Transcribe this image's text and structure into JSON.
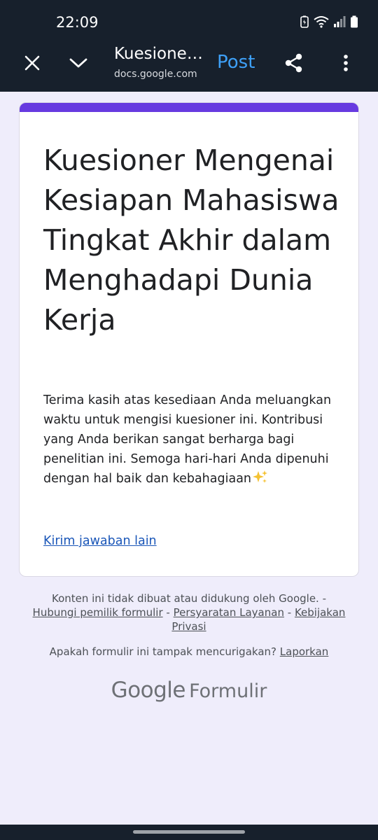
{
  "status_bar": {
    "time": "22:09",
    "icons": [
      "battery-saver-icon",
      "wifi-icon",
      "signal-icon",
      "battery-icon"
    ]
  },
  "browser_toolbar": {
    "title": "Kuesioner Mengenai Kesiapan Mahasiswa Tingkat Akhir dalam Menghadapi Dunia Kerja",
    "url": "docs.google.com",
    "post_label": "Post",
    "icons": [
      "close-icon",
      "chevron-down-icon",
      "share-icon",
      "more-vert-icon"
    ]
  },
  "form": {
    "accent_color": "#673ae0",
    "title": "Kuesioner Mengenai Kesiapan Mahasiswa Tingkat Akhir dalam Menghadapi Dunia Kerja",
    "description": "Terima kasih atas kesediaan Anda meluangkan waktu untuk mengisi kuesioner ini. Kontribusi yang Anda berikan sangat berharga bagi penelitian ini. Semoga hari-hari Anda dipenuhi dengan hal baik dan kebahagiaan",
    "description_emoji": "sparkles-icon",
    "another_response_link": "Kirim jawaban lain"
  },
  "footer": {
    "disclaimer": "Konten ini tidak dibuat atau didukung oleh Google. -",
    "contact_owner": "Hubungi pemilik formulir",
    "sep1": "-",
    "terms": "Persyaratan Layanan",
    "sep2": "-",
    "privacy": "Kebijakan Privasi",
    "suspicious_question": "Apakah formulir ini tampak mencurigakan?",
    "report_link": "Laporkan",
    "brand_google": "Google",
    "brand_product": "Formulir"
  },
  "colors": {
    "toolbar_bg": "#17202c",
    "page_bg": "#efedfb",
    "link": "#1a56b8",
    "post": "#3ea0f7"
  }
}
